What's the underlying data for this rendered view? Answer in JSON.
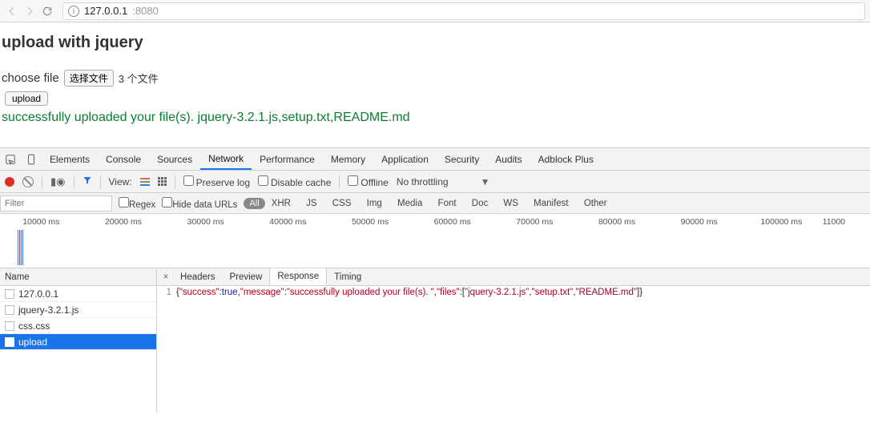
{
  "browser": {
    "back_tooltip": "Back",
    "forward_tooltip": "Forward",
    "reload_tooltip": "Reload",
    "url_host": "127.0.0.1",
    "url_port": ":8080"
  },
  "page": {
    "title": "upload with jquery",
    "choose_label": "choose file",
    "file_button": "选择文件",
    "file_count": "3 个文件",
    "upload_button": "upload",
    "status": "successfully uploaded your file(s). jquery-3.2.1.js,setup.txt,README.md"
  },
  "devtools": {
    "tabs": [
      "Elements",
      "Console",
      "Sources",
      "Network",
      "Performance",
      "Memory",
      "Application",
      "Security",
      "Audits",
      "Adblock Plus"
    ],
    "active_tab": "Network",
    "toolbar": {
      "view_label": "View:",
      "preserve_log": "Preserve log",
      "disable_cache": "Disable cache",
      "offline": "Offline",
      "throttling": "No throttling"
    },
    "filterbar": {
      "filter_placeholder": "Filter",
      "regex": "Regex",
      "hide_data": "Hide data URLs",
      "all": "All",
      "types": [
        "XHR",
        "JS",
        "CSS",
        "Img",
        "Media",
        "Font",
        "Doc",
        "WS",
        "Manifest",
        "Other"
      ]
    },
    "timeline": [
      "10000 ms",
      "20000 ms",
      "30000 ms",
      "40000 ms",
      "50000 ms",
      "60000 ms",
      "70000 ms",
      "80000 ms",
      "90000 ms",
      "100000 ms",
      "11000"
    ],
    "reqlist": {
      "header": "Name",
      "rows": [
        "127.0.0.1",
        "jquery-3.2.1.js",
        "css.css",
        "upload"
      ],
      "selected": "upload"
    },
    "detail": {
      "tabs": [
        "Headers",
        "Preview",
        "Response",
        "Timing"
      ],
      "active": "Response",
      "line": "1",
      "json": {
        "success": true,
        "message": "successfully uploaded your file(s). ",
        "files": [
          "jquery-3.2.1.js",
          "setup.txt",
          "README.md"
        ]
      }
    }
  }
}
